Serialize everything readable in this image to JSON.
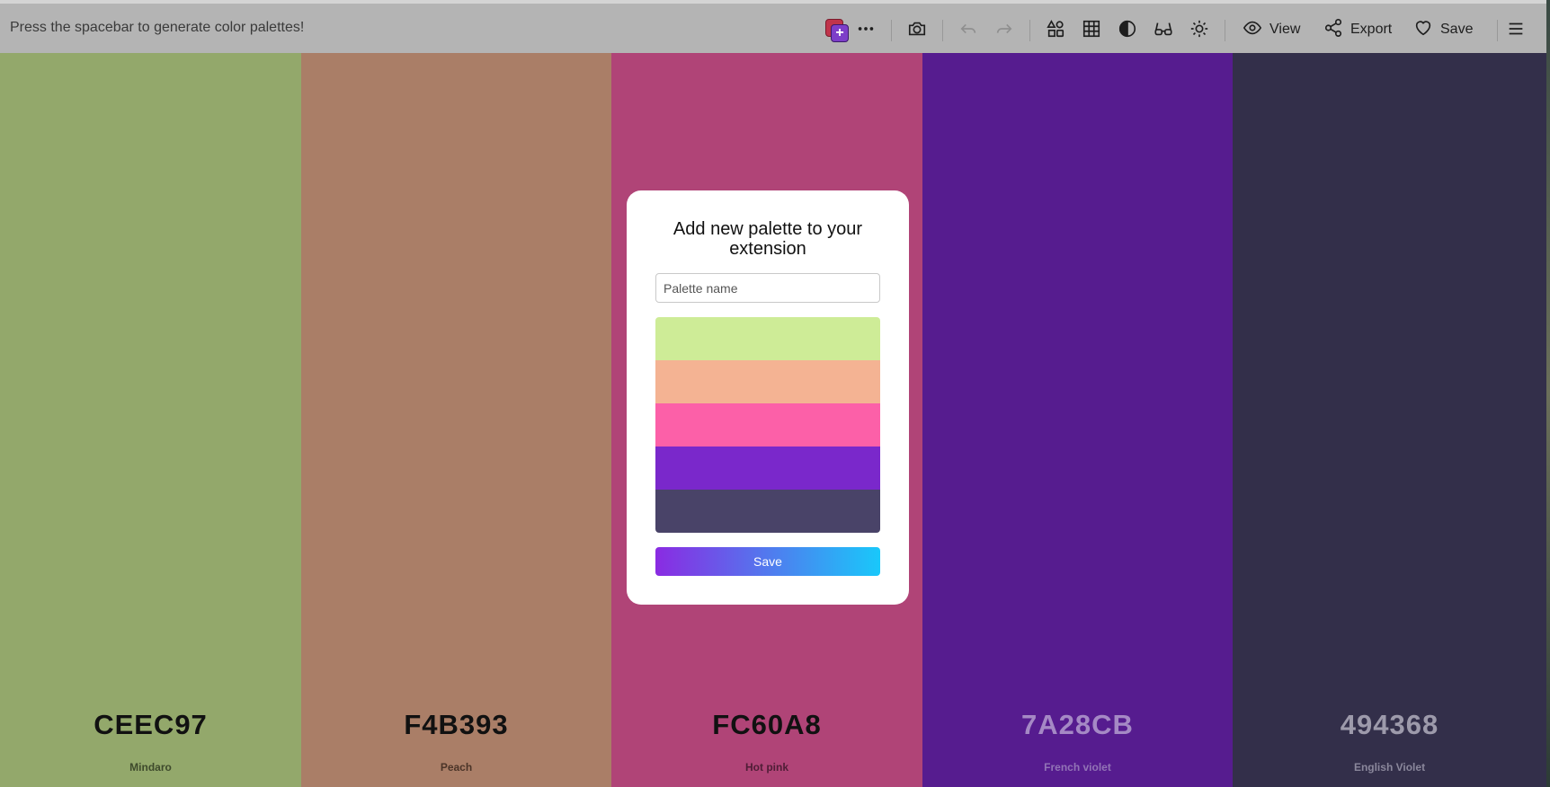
{
  "toolbar": {
    "hint": "Press the spacebar to generate color palettes!",
    "buttons": {
      "view": "View",
      "export": "Export",
      "save": "Save"
    },
    "icons": [
      "extension-icon",
      "more-icon",
      "camera-icon",
      "undo-icon",
      "redo-icon",
      "shapes-icon",
      "grid-icon",
      "contrast-icon",
      "glasses-icon",
      "brightness-icon",
      "eye-icon",
      "share-icon",
      "heart-icon",
      "menu-icon"
    ]
  },
  "palette": [
    {
      "hex": "CEEC97",
      "name": "Mindaro",
      "bg": "#93a86b",
      "text": "#111111",
      "name_color": "#3e4a2c"
    },
    {
      "hex": "F4B393",
      "name": "Peach",
      "bg": "#aa7e67",
      "text": "#111111",
      "name_color": "#4b3428"
    },
    {
      "hex": "FC60A8",
      "name": "Hot pink",
      "bg": "#b04477",
      "text": "#111111",
      "name_color": "#4f1d36"
    },
    {
      "hex": "7A28CB",
      "name": "French violet",
      "bg": "#561c8f",
      "text": "#a589c5",
      "name_color": "#9273b6"
    },
    {
      "hex": "494368",
      "name": "English Violet",
      "bg": "#332f4a",
      "text": "#9d9aab",
      "name_color": "#8a879b"
    }
  ],
  "modal": {
    "title": "Add new palette to your extension",
    "input_placeholder": "Palette name",
    "input_value": "",
    "swatches": [
      "#ceec97",
      "#f4b393",
      "#fc60a8",
      "#7a28cb",
      "#494368"
    ],
    "save_label": "Save"
  }
}
